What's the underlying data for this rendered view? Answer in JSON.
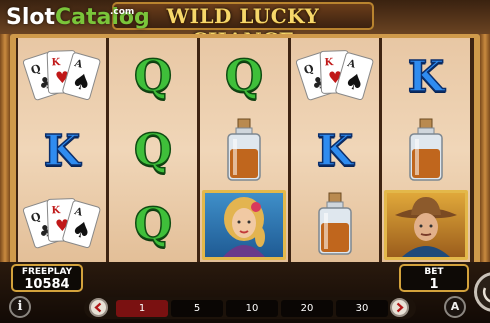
{
  "logo": {
    "slot": "Slot",
    "catalog": "Catalog",
    "com": ".com"
  },
  "game": {
    "title": "WILD LUCKY CHANCE"
  },
  "reels": [
    [
      "cards",
      "K",
      "cards"
    ],
    [
      "Q",
      "Q",
      "Q"
    ],
    [
      "Q",
      "whiskey",
      "woman"
    ],
    [
      "cards",
      "K",
      "whiskey"
    ],
    [
      "K",
      "whiskey",
      "cowboy"
    ]
  ],
  "freeplay": {
    "label": "FREEPLAY",
    "value": "10584"
  },
  "bet": {
    "label": "BET",
    "value": "1"
  },
  "bet_options": [
    "1",
    "5",
    "10",
    "20",
    "30"
  ],
  "selected_bet_option": "1",
  "colors": {
    "accent_gold": "#d3a23c",
    "selected_bet": "#7a1111",
    "q_green": "#3fbf3a",
    "k_blue": "#2f8cf0"
  }
}
